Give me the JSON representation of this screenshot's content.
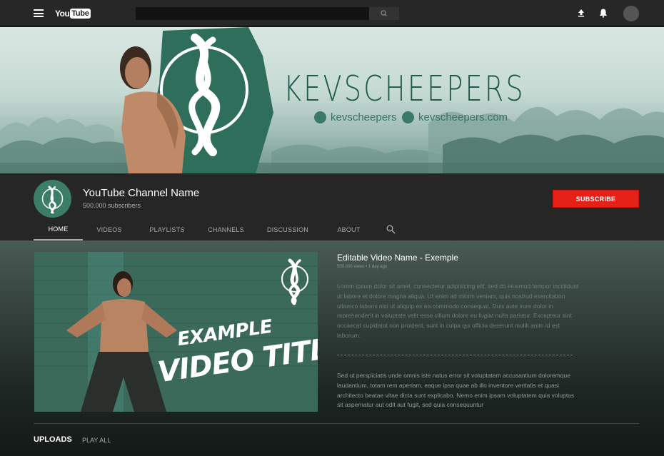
{
  "topbar": {
    "logo_you": "You",
    "logo_tube": "Tube",
    "search_placeholder": "",
    "icons": [
      "menu-icon",
      "search-icon",
      "upload-icon",
      "bell-icon",
      "account-avatar"
    ]
  },
  "banner": {
    "brand": "KEVSCHEEPERS",
    "instagram_handle": "kevscheepers",
    "website": "kevscheepers.com",
    "colors": {
      "brand": "#1f5a4a",
      "sky": "#d9e6e2"
    }
  },
  "channel": {
    "name": "YouTube Channel Name",
    "subscribers": "500.000 subscribers",
    "subscribe_label": "SUBSCRIBE",
    "subscribe_color": "#e62117",
    "tabs": [
      {
        "label": "HOME"
      },
      {
        "label": "VIDEOS"
      },
      {
        "label": "PLAYLISTS"
      },
      {
        "label": "CHANNELS"
      },
      {
        "label": "DISCUSSION"
      },
      {
        "label": "ABOUT"
      }
    ]
  },
  "featured": {
    "thumb_title_line1": "EXAMPLE",
    "thumb_title_line2": "VIDEO TITLE",
    "title": "Editable Video Name - Exemple",
    "meta": "500.000 views • 1 day ago",
    "description_1": "Lorem ipsum dolor sit amet, consectetur adipisicing elit, sed do eiusmod tempor incididunt ut labore et dolore magna aliqua. Ut enim ad minim veniam, quis nostrud exercitation ullamco laboris nisi ut aliquip ex ea commodo consequat. Duis aute irure dolor in reprehenderit in voluptate velit esse cillum dolore eu fugiat nulla pariatur. Excepteur sint occaecat cupidatat non proident, sunt in culpa qui officia deserunt mollit anim id est laborum.",
    "description_2": "Sed ut perspiciatis unde omnis iste natus error sit voluptatem accusantium doloremque laudantium, totam rem aperiam, eaque ipsa quae ab illo inventore veritatis et quasi architecto beatae vitae dicta sunt explicabo. Nemo enim ipsam voluptatem quia voluptas sit aspernatur aut odit aut fugit, sed quia consequuntur"
  },
  "uploads": {
    "label": "UPLOADS",
    "play_all": "PLAY ALL"
  }
}
